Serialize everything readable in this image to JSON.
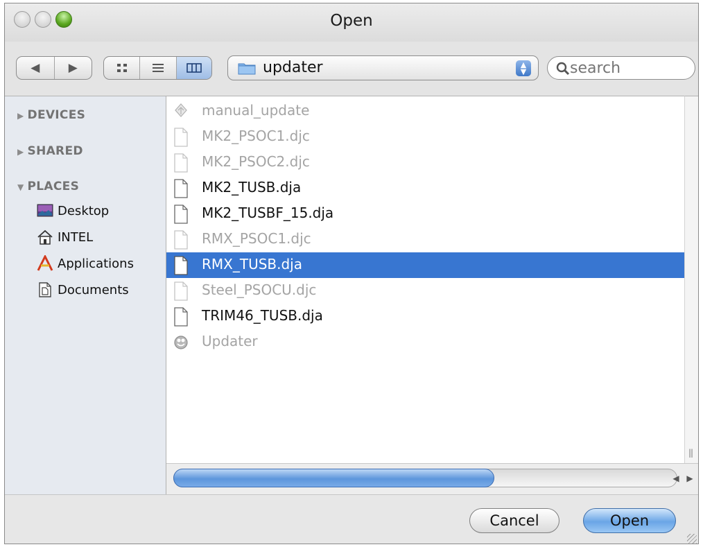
{
  "window": {
    "title": "Open"
  },
  "toolbar": {
    "path_popup_label": "updater",
    "search_placeholder": "search"
  },
  "sidebar": {
    "sections": [
      {
        "label": "DEVICES",
        "expanded": false
      },
      {
        "label": "SHARED",
        "expanded": false
      },
      {
        "label": "PLACES",
        "expanded": true
      }
    ],
    "places": [
      {
        "label": "Desktop",
        "icon": "desktop-icon"
      },
      {
        "label": "INTEL",
        "icon": "home-icon"
      },
      {
        "label": "Applications",
        "icon": "applications-icon"
      },
      {
        "label": "Documents",
        "icon": "documents-icon"
      }
    ]
  },
  "files": [
    {
      "name": "manual_update",
      "icon": "alias-icon",
      "enabled": false,
      "selected": false
    },
    {
      "name": "MK2_PSOC1.djc",
      "icon": "document-icon",
      "enabled": false,
      "selected": false
    },
    {
      "name": "MK2_PSOC2.djc",
      "icon": "document-icon",
      "enabled": false,
      "selected": false
    },
    {
      "name": "MK2_TUSB.dja",
      "icon": "document-icon",
      "enabled": true,
      "selected": false
    },
    {
      "name": "MK2_TUSBF_15.dja",
      "icon": "document-icon",
      "enabled": true,
      "selected": false
    },
    {
      "name": "RMX_PSOC1.djc",
      "icon": "document-icon",
      "enabled": false,
      "selected": false
    },
    {
      "name": "RMX_TUSB.dja",
      "icon": "document-icon",
      "enabled": true,
      "selected": true
    },
    {
      "name": "Steel_PSOCU.djc",
      "icon": "document-icon",
      "enabled": false,
      "selected": false
    },
    {
      "name": "TRIM46_TUSB.dja",
      "icon": "document-icon",
      "enabled": true,
      "selected": false
    },
    {
      "name": "Updater",
      "icon": "application-icon",
      "enabled": false,
      "selected": false
    }
  ],
  "buttons": {
    "cancel": "Cancel",
    "open": "Open"
  },
  "colors": {
    "selection": "#3876d1",
    "sidebar_bg": "#e6eaf0",
    "dim_text": "#a4a4a4"
  }
}
